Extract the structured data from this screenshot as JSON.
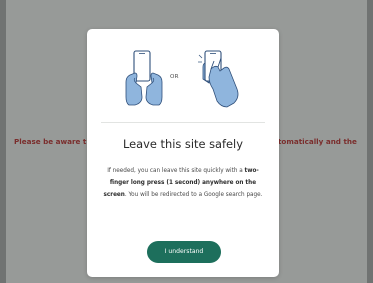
{
  "background": {
    "warning_left": "Please be aware th",
    "warning_right": "tomatically and the"
  },
  "modal": {
    "illustration": {
      "left_icon": "phone-two-hands-icon",
      "right_icon": "phone-two-finger-press-icon",
      "or_label": "OR"
    },
    "title": "Leave this site safely",
    "body": {
      "part1": "If needed, you can leave this site quickly with a ",
      "bold": "two-finger long press (1 second) anywhere on the screen",
      "part2": ". You will be redirected to a Google search page."
    },
    "button_label": "I understand"
  },
  "colors": {
    "accent": "#1d6f5c",
    "warning_text": "#b41d1d",
    "illustration_blue": "#8fb5dd",
    "illustration_outline": "#2f4f7a"
  }
}
